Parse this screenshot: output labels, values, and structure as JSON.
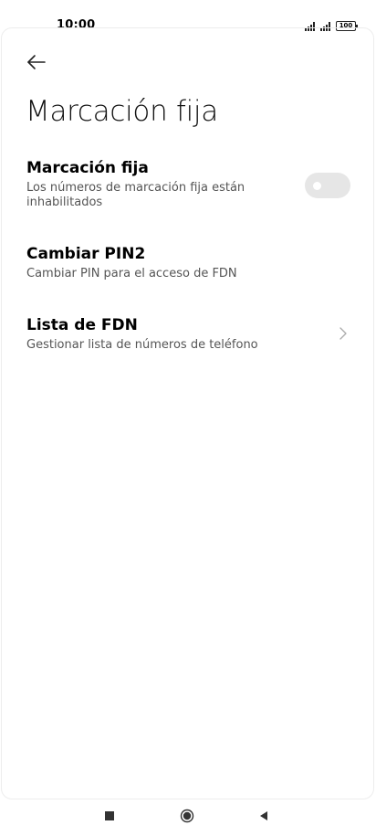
{
  "status_bar": {
    "time": "10:00",
    "battery": "100"
  },
  "header": {
    "title": "Marcación fija",
    "back_icon": "arrow-left-icon"
  },
  "settings": [
    {
      "title": "Marcación fija",
      "subtitle": "Los números de marcación fija están inhabilitados",
      "control": "toggle",
      "enabled": false
    },
    {
      "title": "Cambiar PIN2",
      "subtitle": "Cambiar PIN para el acceso de FDN"
    },
    {
      "title": "Lista de FDN",
      "subtitle": "Gestionar lista de números de teléfono",
      "control": "chevron-right-icon"
    }
  ],
  "nav_bar": {
    "recents_icon": "square-icon",
    "home_icon": "circle-icon",
    "back_icon": "triangle-back-icon"
  },
  "colors": {
    "toggle_off": "#e6e6e6",
    "subtitle": "#555555",
    "background": "#ffffff"
  }
}
